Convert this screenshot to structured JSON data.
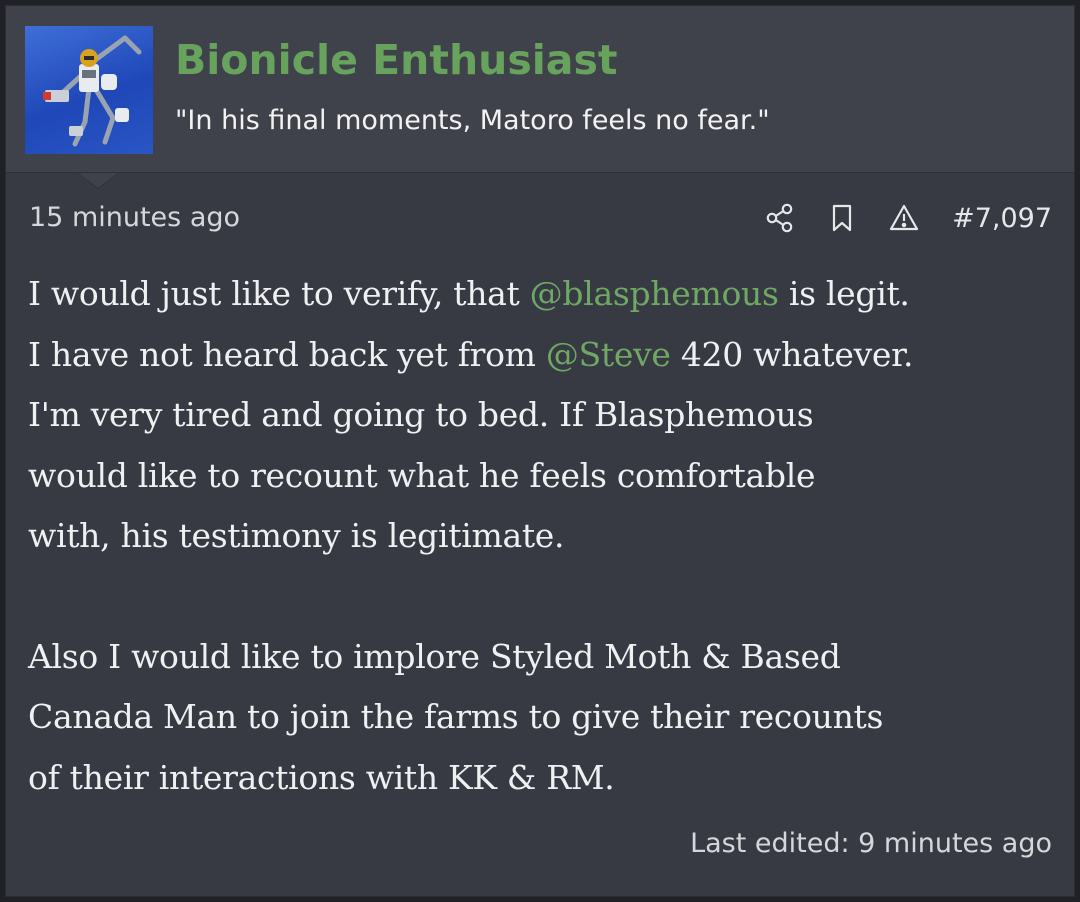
{
  "user": {
    "name": "Bionicle Enthusiast",
    "title": "\"In his final moments, Matoro feels no fear.\"",
    "avatar_icon": "bionicle-figure-avatar"
  },
  "post": {
    "timestamp": "15 minutes ago",
    "number": "#7,097",
    "actions": [
      "share-icon",
      "bookmark-icon",
      "report-icon"
    ],
    "lines": [
      {
        "before": "I would just like to verify, that ",
        "mention": "@blasphemous",
        "after": " is legit."
      },
      {
        "before": "I have not heard back yet from ",
        "mention": "@Steve",
        "after": " 420 whatever."
      },
      {
        "text": "I'm very tired and going to bed. If Blasphemous"
      },
      {
        "text": "would like to recount what he feels comfortable"
      },
      {
        "text": "with, his testimony is legitimate."
      },
      {
        "text": "Also I would like to implore Styled Moth & Based"
      },
      {
        "text": "Canada Man to join the farms to give their recounts"
      },
      {
        "text": "of their interactions with KK & RM."
      }
    ],
    "last_edited": "Last edited: 9 minutes ago"
  },
  "colors": {
    "background": "#373a42",
    "header": "#3f424a",
    "username": "#67a35c",
    "mention": "#6fa864",
    "text": "#eef0f2"
  }
}
